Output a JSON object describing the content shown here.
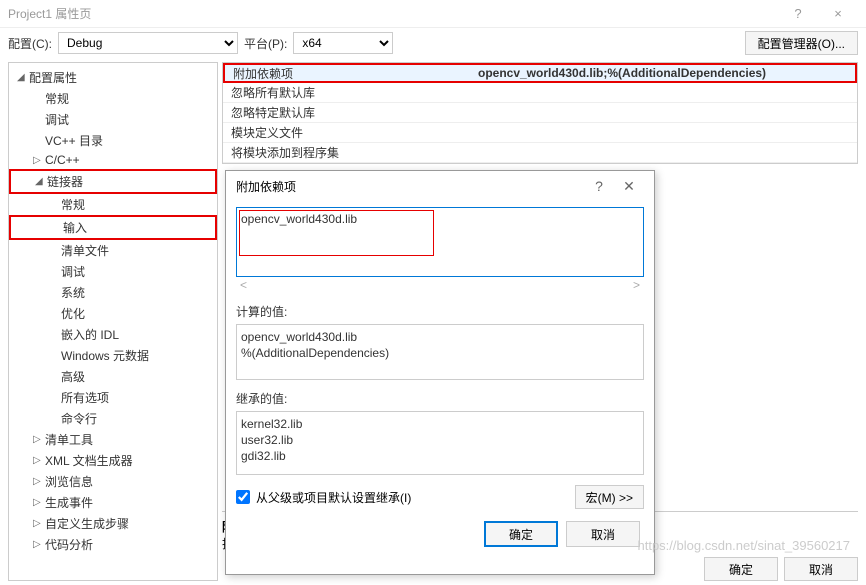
{
  "window": {
    "title": "Project1 属性页",
    "help_icon": "?",
    "close_icon": "×"
  },
  "toolbar": {
    "config_label": "配置(C):",
    "config_value": "Debug",
    "platform_label": "平台(P):",
    "platform_value": "x64",
    "config_manager": "配置管理器(O)..."
  },
  "tree": [
    {
      "label": "配置属性",
      "level": 0,
      "arrow": "◢"
    },
    {
      "label": "常规",
      "level": 1
    },
    {
      "label": "调试",
      "level": 1
    },
    {
      "label": "VC++ 目录",
      "level": 1
    },
    {
      "label": "C/C++",
      "level": 1,
      "arrow": "▷"
    },
    {
      "label": "链接器",
      "level": 1,
      "arrow": "◢",
      "red": true
    },
    {
      "label": "常规",
      "level": 2
    },
    {
      "label": "输入",
      "level": 2,
      "red": true
    },
    {
      "label": "清单文件",
      "level": 2
    },
    {
      "label": "调试",
      "level": 2
    },
    {
      "label": "系统",
      "level": 2
    },
    {
      "label": "优化",
      "level": 2
    },
    {
      "label": "嵌入的 IDL",
      "level": 2
    },
    {
      "label": "Windows 元数据",
      "level": 2
    },
    {
      "label": "高级",
      "level": 2
    },
    {
      "label": "所有选项",
      "level": 2
    },
    {
      "label": "命令行",
      "level": 2
    },
    {
      "label": "清单工具",
      "level": 1,
      "arrow": "▷"
    },
    {
      "label": "XML 文档生成器",
      "level": 1,
      "arrow": "▷"
    },
    {
      "label": "浏览信息",
      "level": 1,
      "arrow": "▷"
    },
    {
      "label": "生成事件",
      "level": 1,
      "arrow": "▷"
    },
    {
      "label": "自定义生成步骤",
      "level": 1,
      "arrow": "▷"
    },
    {
      "label": "代码分析",
      "level": 1,
      "arrow": "▷"
    }
  ],
  "props": {
    "rows": [
      {
        "label": "附加依赖项",
        "value": "opencv_world430d.lib;%(AdditionalDependencies)",
        "selected": true
      },
      {
        "label": "忽略所有默认库",
        "value": ""
      },
      {
        "label": "忽略特定默认库",
        "value": ""
      },
      {
        "label": "模块定义文件",
        "value": ""
      },
      {
        "label": "将模块添加到程序集",
        "value": ""
      }
    ],
    "desc_title": "附加",
    "desc_text": "指定",
    "ok": "确定",
    "cancel": "取消"
  },
  "dialog": {
    "title": "附加依赖项",
    "help_icon": "?",
    "close_icon": "✕",
    "edit_value": "opencv_world430d.lib",
    "computed_label": "计算的值:",
    "computed_lines": [
      "opencv_world430d.lib",
      "%(AdditionalDependencies)"
    ],
    "inherited_label": "继承的值:",
    "inherited_lines": [
      "kernel32.lib",
      "user32.lib",
      "gdi32.lib"
    ],
    "inherit_checkbox": "从父级或项目默认设置继承(I)",
    "inherit_checked": true,
    "macro_btn": "宏(M) >>",
    "ok": "确定",
    "cancel": "取消"
  },
  "watermark": "https://blog.csdn.net/sinat_39560217"
}
